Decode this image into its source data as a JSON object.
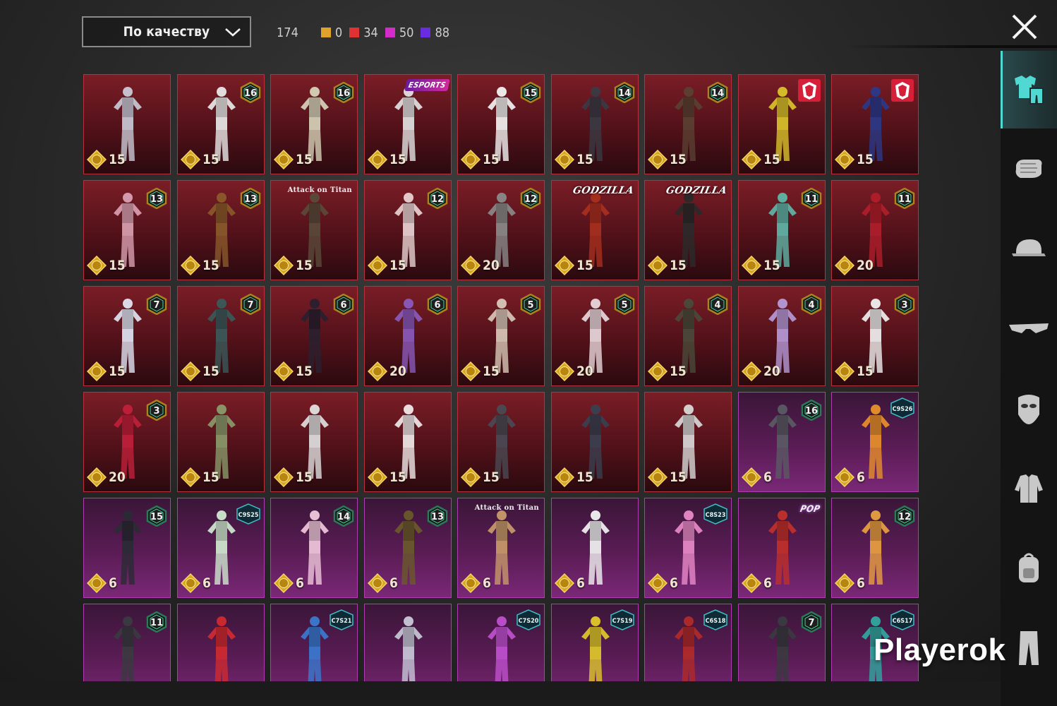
{
  "sort": {
    "label": "По качеству"
  },
  "counts": {
    "total": "174",
    "items": [
      {
        "color": "#e0a22b",
        "value": "0"
      },
      {
        "color": "#e03232",
        "value": "34"
      },
      {
        "color": "#d22cc9",
        "value": "50"
      },
      {
        "color": "#6a2ce0",
        "value": "88"
      }
    ]
  },
  "sidebar": {
    "categories": [
      {
        "icon": "outfit-icon",
        "active": true
      },
      {
        "icon": "glove-icon",
        "active": false
      },
      {
        "icon": "cap-icon",
        "active": false
      },
      {
        "icon": "glasses-icon",
        "active": false
      },
      {
        "icon": "mask-icon",
        "active": false
      },
      {
        "icon": "jacket-icon",
        "active": false
      },
      {
        "icon": "backpack-icon",
        "active": false
      },
      {
        "icon": "pants-icon",
        "active": false
      }
    ]
  },
  "colors": {
    "red_tile": "#7a1d26",
    "purple_tile": "#5a1c55",
    "accent": "#4fd9d2"
  },
  "watermark": "Playerok",
  "items": [
    {
      "rarity": "red",
      "badge": "",
      "tag": "",
      "price": "15",
      "tint": "#c9c9d6"
    },
    {
      "rarity": "red",
      "badge": "16",
      "tag": "",
      "price": "15",
      "tint": "#e8e8e8"
    },
    {
      "rarity": "red",
      "badge": "16",
      "tag": "",
      "price": "15",
      "tint": "#d6d2b8"
    },
    {
      "rarity": "red",
      "badge": "",
      "tag": "ESPORTS",
      "tagtype": "esports",
      "price": "15",
      "tint": "#e2e2e2"
    },
    {
      "rarity": "red",
      "badge": "15",
      "tag": "",
      "price": "15",
      "tint": "#f2f2f2"
    },
    {
      "rarity": "red",
      "badge": "14",
      "tag": "",
      "price": "15",
      "tint": "#3a3a44"
    },
    {
      "rarity": "red",
      "badge": "14",
      "tag": "",
      "price": "15",
      "tint": "#5a4032"
    },
    {
      "rarity": "red",
      "badge": "",
      "tag": "",
      "tf": true,
      "price": "15",
      "tint": "#d9c32a"
    },
    {
      "rarity": "red",
      "badge": "",
      "tag": "",
      "tf": true,
      "price": "15",
      "tint": "#2a3a8a"
    },
    {
      "rarity": "red",
      "badge": "13",
      "tag": "",
      "price": "15",
      "tint": "#d9a0b2"
    },
    {
      "rarity": "red",
      "badge": "13",
      "tag": "",
      "price": "15",
      "tint": "#8a5a2a"
    },
    {
      "rarity": "red",
      "badge": "",
      "tag": "Attack on Titan",
      "tagtype": "aot",
      "price": "15",
      "tint": "#5a4a3a"
    },
    {
      "rarity": "red",
      "badge": "12",
      "tag": "",
      "price": "15",
      "tint": "#e8d2d2"
    },
    {
      "rarity": "red",
      "badge": "12",
      "tag": "",
      "price": "20",
      "tint": "#8a8a8a"
    },
    {
      "rarity": "red",
      "badge": "",
      "tag": "GODZILLA",
      "tagtype": "godzilla",
      "price": "15",
      "tint": "#a8301e"
    },
    {
      "rarity": "red",
      "badge": "",
      "tag": "GODZILLA",
      "tagtype": "godzilla",
      "price": "15",
      "tint": "#2a2a2a"
    },
    {
      "rarity": "red",
      "badge": "11",
      "tag": "",
      "price": "15",
      "tint": "#5fb5a8"
    },
    {
      "rarity": "red",
      "badge": "11",
      "tag": "",
      "price": "20",
      "tint": "#b01e2a"
    },
    {
      "rarity": "red",
      "badge": "7",
      "tag": "",
      "price": "15",
      "tint": "#e0e4f2"
    },
    {
      "rarity": "red",
      "badge": "7",
      "tag": "",
      "price": "15",
      "tint": "#3a5a5a"
    },
    {
      "rarity": "red",
      "badge": "6",
      "tag": "",
      "price": "15",
      "tint": "#2a2030"
    },
    {
      "rarity": "red",
      "badge": "6",
      "tag": "",
      "price": "20",
      "tint": "#8a5abc"
    },
    {
      "rarity": "red",
      "badge": "5",
      "tag": "",
      "price": "15",
      "tint": "#d8c8b8"
    },
    {
      "rarity": "red",
      "badge": "5",
      "tag": "",
      "price": "20",
      "tint": "#e8d8dc"
    },
    {
      "rarity": "red",
      "badge": "4",
      "tag": "",
      "price": "15",
      "tint": "#4a4a3a"
    },
    {
      "rarity": "red",
      "badge": "4",
      "tag": "",
      "price": "20",
      "tint": "#b69ad8"
    },
    {
      "rarity": "red",
      "badge": "3",
      "tag": "",
      "price": "15",
      "tint": "#f0f0f0"
    },
    {
      "rarity": "red",
      "badge": "3",
      "tag": "",
      "price": "20",
      "tint": "#c0203a"
    },
    {
      "rarity": "red",
      "badge": "",
      "tag": "",
      "price": "15",
      "tint": "#8a9a6a"
    },
    {
      "rarity": "red",
      "badge": "",
      "tag": "",
      "price": "15",
      "tint": "#e0e0e0"
    },
    {
      "rarity": "red",
      "badge": "",
      "tag": "",
      "price": "15",
      "tint": "#f0e8e8"
    },
    {
      "rarity": "red",
      "badge": "",
      "tag": "",
      "price": "15",
      "tint": "#4a4a54"
    },
    {
      "rarity": "red",
      "badge": "",
      "tag": "",
      "price": "15",
      "tint": "#3a4050"
    },
    {
      "rarity": "red",
      "badge": "",
      "tag": "",
      "price": "15",
      "tint": "#d8d8d8"
    },
    {
      "rarity": "purple",
      "badge": "16",
      "tag": "",
      "price": "6",
      "tint": "#5a5a64"
    },
    {
      "rarity": "purple",
      "badge": "",
      "season": "C9S26",
      "tag": "",
      "price": "6",
      "tint": "#e8902a"
    },
    {
      "rarity": "purple",
      "badge": "15",
      "tag": "",
      "price": "6",
      "tint": "#2a2a34"
    },
    {
      "rarity": "purple",
      "badge": "",
      "season": "C9S25",
      "tag": "",
      "price": "6",
      "tint": "#d0e8d0"
    },
    {
      "rarity": "purple",
      "badge": "14",
      "tag": "",
      "price": "6",
      "tint": "#f0c8dc"
    },
    {
      "rarity": "purple",
      "badge": "13",
      "tag": "",
      "price": "6",
      "tint": "#6a5a2a"
    },
    {
      "rarity": "purple",
      "badge": "",
      "tag": "Attack on Titan",
      "tagtype": "aot",
      "price": "6",
      "tint": "#c89a6a"
    },
    {
      "rarity": "purple",
      "badge": "",
      "tag": "",
      "price": "6",
      "tint": "#f2f2f2"
    },
    {
      "rarity": "purple",
      "badge": "",
      "season": "C8S23",
      "tag": "",
      "price": "6",
      "tint": "#e88ac8"
    },
    {
      "rarity": "purple",
      "badge": "",
      "tag": "POP",
      "tagtype": "pop",
      "price": "6",
      "tint": "#c0302a"
    },
    {
      "rarity": "purple",
      "badge": "12",
      "tag": "",
      "price": "6",
      "tint": "#e8a040"
    },
    {
      "rarity": "purple",
      "badge": "11",
      "tag": "",
      "price": "",
      "tint": "#3a3a40"
    },
    {
      "rarity": "purple",
      "badge": "",
      "tag": "",
      "price": "",
      "tint": "#d02a30"
    },
    {
      "rarity": "purple",
      "badge": "",
      "season": "C7S21",
      "tag": "",
      "price": "",
      "tint": "#3a7ad0"
    },
    {
      "rarity": "purple",
      "badge": "",
      "tag": "",
      "price": "",
      "tint": "#c8c8d8"
    },
    {
      "rarity": "purple",
      "badge": "",
      "season": "C7S20",
      "tag": "",
      "price": "",
      "tint": "#c050d0"
    },
    {
      "rarity": "purple",
      "badge": "",
      "season": "C7S19",
      "tag": "",
      "price": "",
      "tint": "#e0c82a"
    },
    {
      "rarity": "purple",
      "badge": "",
      "season": "C6S18",
      "tag": "",
      "price": "",
      "tint": "#b02a2a"
    },
    {
      "rarity": "purple",
      "badge": "7",
      "tag": "",
      "price": "",
      "tint": "#3a3a40"
    },
    {
      "rarity": "purple",
      "badge": "",
      "season": "C6S17",
      "tag": "",
      "price": "",
      "tint": "#30a8a0"
    }
  ]
}
